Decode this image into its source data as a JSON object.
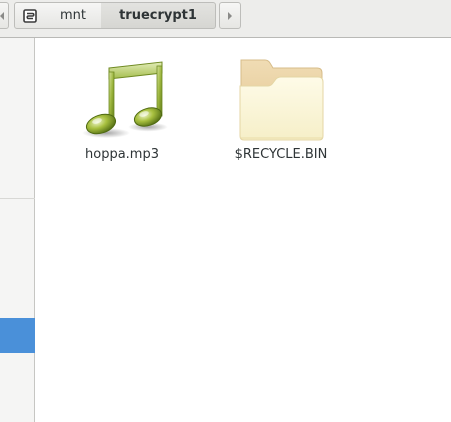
{
  "pathbar": {
    "segments": [
      {
        "label": "mnt"
      },
      {
        "label": "truecrypt1"
      }
    ]
  },
  "files": [
    {
      "name": "hoppa.mp3",
      "icon": "audio-file-icon"
    },
    {
      "name": "$RECYCLE.BIN",
      "icon": "folder-icon"
    }
  ],
  "colors": {
    "selection": "#4a90d9",
    "pathbar_bg": "#ededeb"
  }
}
